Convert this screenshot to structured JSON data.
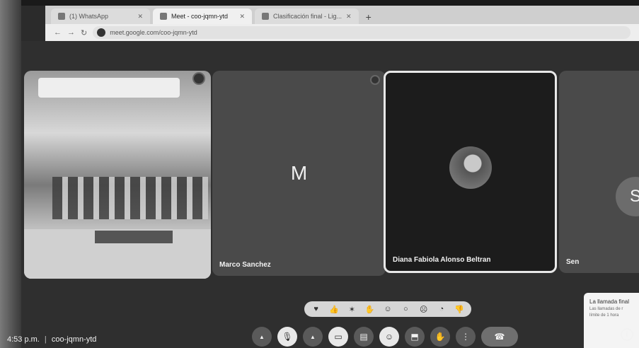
{
  "browser": {
    "tabs": [
      {
        "label": "(1) WhatsApp",
        "active": false
      },
      {
        "label": "Meet - coo-jqmn-ytd",
        "active": true
      },
      {
        "label": "Clasificación final - Lig...",
        "active": false
      }
    ],
    "new_tab": "+",
    "url": "meet.google.com/coo-jqmn-ytd"
  },
  "participants": [
    {
      "name": "",
      "kind": "room-video"
    },
    {
      "name": "Marco Sanchez",
      "letter": "M"
    },
    {
      "name": "Diana Fabiola Alonso Beltran",
      "speaking": true
    },
    {
      "name": "Sen",
      "letter": "S"
    }
  ],
  "notification": {
    "title": "La llamada final",
    "line1": "Las llamadas de r",
    "line2": "límite de 1 hora"
  },
  "reactions": [
    "heart",
    "thumbs-up",
    "party",
    "clap",
    "laugh",
    "surprised",
    "sad",
    "thinking",
    "thumbs-down"
  ],
  "footer": {
    "time": "4:53 p.m.",
    "separator": "|",
    "meeting_code": "coo-jqmn-ytd"
  },
  "controls": {
    "mic": "mic",
    "camera": "camera",
    "captions": "captions",
    "emoji": "emoji",
    "present": "present",
    "hand": "raise-hand",
    "more": "more",
    "end": "end-call",
    "info": "i"
  },
  "colors": {
    "background": "#2f2f2f",
    "tile": "#4a4a4a",
    "speaking_border": "#e8e8e8"
  }
}
